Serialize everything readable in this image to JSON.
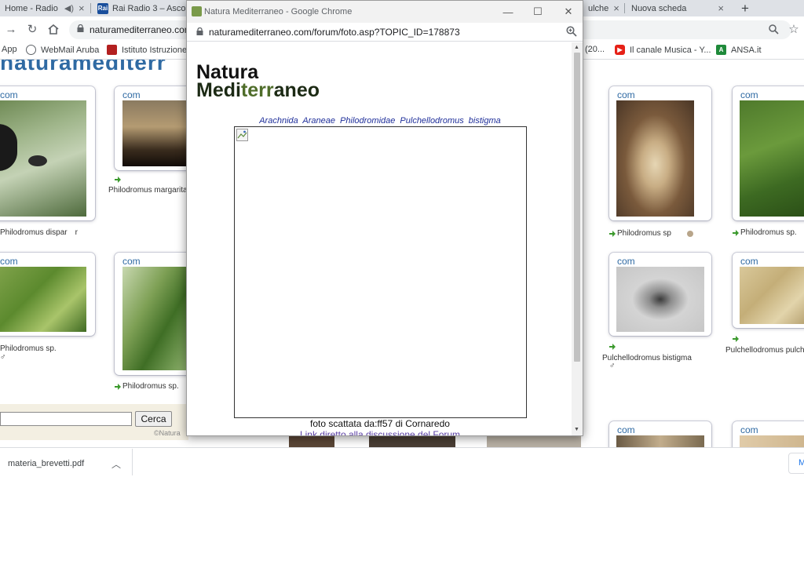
{
  "browser": {
    "tabs": [
      {
        "label": "Home - Radio",
        "icon": "radio-icon"
      },
      {
        "label": "Rai Radio 3 – Ascolta",
        "icon": "rai-icon"
      },
      {
        "label": "",
        "icon": "natura-icon"
      },
      {
        "label": "ulche",
        "icon": "natura-icon"
      },
      {
        "label": "Nuova scheda",
        "icon": ""
      }
    ],
    "address": "naturamediterraneo.con",
    "bookmarks": [
      {
        "label": "App",
        "icon": "apps-grid-icon"
      },
      {
        "label": "WebMail Aruba",
        "icon": "globe-icon"
      },
      {
        "label": "Istituto Istruzione S",
        "icon": "school-icon"
      },
      {
        "label": "(20...",
        "icon": ""
      },
      {
        "label": "Il canale Musica - Y...",
        "icon": "youtube-icon"
      },
      {
        "label": "ANSA.it",
        "icon": "ansa-icon"
      }
    ]
  },
  "gallery": {
    "com_label": "com",
    "left_cards": [
      {
        "caption": "Philodromus dispar",
        "suffix": "r",
        "male": false
      },
      {
        "caption": "Philodromus margarita",
        "suffix": "",
        "male": false
      },
      {
        "caption": "Philodromus sp.",
        "suffix": "",
        "male": true
      },
      {
        "caption": "Philodromus sp.",
        "suffix": "",
        "male": false
      }
    ],
    "right_cards": [
      {
        "caption": "Philodromus sp",
        "male": false
      },
      {
        "caption": "Philodromus sp.",
        "male": false
      },
      {
        "caption": "Pulchellodromus bistigma",
        "male": true
      },
      {
        "caption": "Pulchellodromus pulch",
        "male": false
      }
    ],
    "male_symbol": "♂",
    "search_button": "Cerca",
    "footer": "©Natura"
  },
  "downloads": {
    "file": "materia_brevetti.pdf",
    "button": "M"
  },
  "popup": {
    "window_title": "Natura Mediterraneo - Google Chrome",
    "url": "naturamediterraneo.com/forum/foto.asp?TOPIC_ID=178873",
    "logo_line1": "Natura",
    "logo_line2a": "Medi",
    "logo_line2b": "terr",
    "logo_line2c": "aneo",
    "taxonomy": "Arachnida  Araneae  Philodromidae  Pulchellodromus bistigma",
    "photo_by": "foto scattata da:ff57 di Cornaredo",
    "link": "Link diretto alla discussione del Forum"
  }
}
